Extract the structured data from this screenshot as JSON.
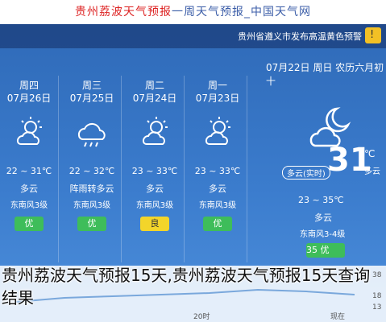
{
  "header": {
    "title_part1": "贵州荔波天气预报",
    "title_part2": "一周天气预报_中国天气网"
  },
  "alert": {
    "text": "贵州省遵义市发布高温黄色预警",
    "icon": "alert-warning-icon"
  },
  "today": {
    "date_line": "07月22日 周日 农历六月初十",
    "temp_now": "31",
    "unit": "℃",
    "condition": "多云",
    "feels_like": "多云(实时)",
    "range": "23 ~ 35℃",
    "weather": "多云",
    "wind": "东南风3-4级",
    "aqi": "35 优",
    "icon": "partly-cloudy-night-icon"
  },
  "days": [
    {
      "weekday": "周四",
      "date": "07月26日",
      "icon": "sun-cloud-icon",
      "range": "22 ~ 31℃",
      "weather": "多云",
      "wind": "东南风3级",
      "aqi": "优",
      "aqi_level": "good"
    },
    {
      "weekday": "周三",
      "date": "07月25日",
      "icon": "rain-cloud-icon",
      "range": "22 ~ 32℃",
      "weather": "阵雨转多云",
      "wind": "东南风3级",
      "aqi": "优",
      "aqi_level": "good"
    },
    {
      "weekday": "周二",
      "date": "07月24日",
      "icon": "sun-cloud-icon",
      "range": "23 ~ 33℃",
      "weather": "多云",
      "wind": "东南风3级",
      "aqi": "良",
      "aqi_level": "mod"
    },
    {
      "weekday": "周一",
      "date": "07月23日",
      "icon": "sun-cloud-icon",
      "range": "23 ~ 33℃",
      "weather": "多云",
      "wind": "东南风3级",
      "aqi": "优",
      "aqi_level": "good"
    }
  ],
  "chart_axis": {
    "labels": [
      "38",
      "18",
      "13"
    ],
    "bottom": [
      "20时",
      "现在"
    ]
  },
  "caption": "贵州荔波天气预报15天,贵州荔波天气预报15天查询结果"
}
